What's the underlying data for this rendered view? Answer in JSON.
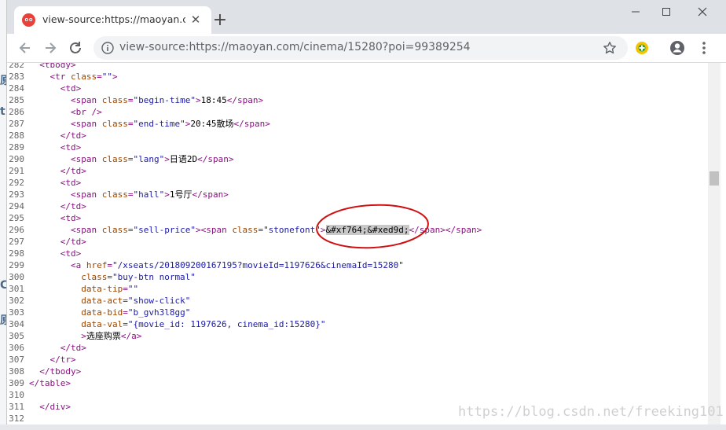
{
  "background_chars": [
    "原",
    "t",
    "C",
    "原"
  ],
  "browser": {
    "tab_title": "view-source:https://maoyan.cc",
    "new_tab_symbol": "+",
    "url": "view-source:https://maoyan.com/cinema/15280?poi=99389254",
    "window_controls": {
      "minimize": "—",
      "maximize": "☐",
      "close": "✕"
    }
  },
  "source_lines": [
    {
      "n": "282",
      "tokens": [
        [
          "t",
          "  <tbody>"
        ]
      ]
    },
    {
      "n": "283",
      "tokens": [
        [
          "t",
          "    <tr "
        ],
        [
          "a",
          "class"
        ],
        [
          "t",
          "="
        ],
        [
          "v",
          "\"\""
        ],
        [
          "t",
          ">"
        ]
      ]
    },
    {
      "n": "284",
      "tokens": [
        [
          "t",
          "      <td>"
        ]
      ]
    },
    {
      "n": "285",
      "tokens": [
        [
          "t",
          "        <span "
        ],
        [
          "a",
          "class"
        ],
        [
          "t",
          "="
        ],
        [
          "v",
          "\"begin-time\""
        ],
        [
          "t",
          ">"
        ],
        [
          "x",
          "18:45"
        ],
        [
          "t",
          "</span>"
        ]
      ]
    },
    {
      "n": "286",
      "tokens": [
        [
          "t",
          "        <br />"
        ]
      ]
    },
    {
      "n": "287",
      "tokens": [
        [
          "t",
          "        <span "
        ],
        [
          "a",
          "class"
        ],
        [
          "t",
          "="
        ],
        [
          "v",
          "\"end-time\""
        ],
        [
          "t",
          ">"
        ],
        [
          "x",
          "20:45散场"
        ],
        [
          "t",
          "</span>"
        ]
      ]
    },
    {
      "n": "288",
      "tokens": [
        [
          "t",
          "      </td>"
        ]
      ]
    },
    {
      "n": "289",
      "tokens": [
        [
          "t",
          "      <td>"
        ]
      ]
    },
    {
      "n": "290",
      "tokens": [
        [
          "t",
          "        <span "
        ],
        [
          "a",
          "class"
        ],
        [
          "t",
          "="
        ],
        [
          "v",
          "\"lang\""
        ],
        [
          "t",
          ">"
        ],
        [
          "x",
          "日语2D"
        ],
        [
          "t",
          "</span>"
        ]
      ]
    },
    {
      "n": "291",
      "tokens": [
        [
          "t",
          "      </td>"
        ]
      ]
    },
    {
      "n": "292",
      "tokens": [
        [
          "t",
          "      <td>"
        ]
      ]
    },
    {
      "n": "293",
      "tokens": [
        [
          "t",
          "        <span "
        ],
        [
          "a",
          "class"
        ],
        [
          "t",
          "="
        ],
        [
          "v",
          "\"hall\""
        ],
        [
          "t",
          ">"
        ],
        [
          "x",
          "1号厅"
        ],
        [
          "t",
          "</span>"
        ]
      ]
    },
    {
      "n": "294",
      "tokens": [
        [
          "t",
          "      </td>"
        ]
      ]
    },
    {
      "n": "295",
      "tokens": [
        [
          "t",
          "      <td>"
        ]
      ]
    },
    {
      "n": "296",
      "tokens": [
        [
          "t",
          "        <span "
        ],
        [
          "a",
          "class"
        ],
        [
          "t",
          "="
        ],
        [
          "v",
          "\"sell-price\""
        ],
        [
          "t",
          "><span "
        ],
        [
          "a",
          "class"
        ],
        [
          "t",
          "="
        ],
        [
          "v",
          "\"stonefont\""
        ],
        [
          "t",
          ">"
        ],
        [
          "hl",
          "&#xf764;&#xed9d;"
        ],
        [
          "t",
          "</span></span>"
        ]
      ]
    },
    {
      "n": "297",
      "tokens": [
        [
          "t",
          "      </td>"
        ]
      ]
    },
    {
      "n": "298",
      "tokens": [
        [
          "t",
          "      <td>"
        ]
      ]
    },
    {
      "n": "299",
      "tokens": [
        [
          "t",
          "        <a "
        ],
        [
          "a",
          "href"
        ],
        [
          "t",
          "="
        ],
        [
          "v",
          "\"/xseats/201809200167195?movieId=1197626&cinemaId=15280\""
        ]
      ]
    },
    {
      "n": "300",
      "tokens": [
        [
          "a",
          "          class"
        ],
        [
          "t",
          "="
        ],
        [
          "v",
          "\"buy-btn normal\""
        ]
      ]
    },
    {
      "n": "301",
      "tokens": [
        [
          "a",
          "          data-tip"
        ],
        [
          "t",
          "="
        ],
        [
          "v",
          "\"\""
        ]
      ]
    },
    {
      "n": "302",
      "tokens": [
        [
          "a",
          "          data-act"
        ],
        [
          "t",
          "="
        ],
        [
          "v",
          "\"show-click\""
        ]
      ]
    },
    {
      "n": "303",
      "tokens": [
        [
          "a",
          "          data-bid"
        ],
        [
          "t",
          "="
        ],
        [
          "v",
          "\"b_gvh3l8gg\""
        ]
      ]
    },
    {
      "n": "304",
      "tokens": [
        [
          "a",
          "          data-val"
        ],
        [
          "t",
          "="
        ],
        [
          "v",
          "\"{movie_id: 1197626, cinema_id:15280}\""
        ]
      ]
    },
    {
      "n": "305",
      "tokens": [
        [
          "t",
          "          >"
        ],
        [
          "x",
          "选座购票"
        ],
        [
          "t",
          "</a>"
        ]
      ]
    },
    {
      "n": "306",
      "tokens": [
        [
          "t",
          "      </td>"
        ]
      ]
    },
    {
      "n": "307",
      "tokens": [
        [
          "t",
          "    </tr>"
        ]
      ]
    },
    {
      "n": "308",
      "tokens": [
        [
          "t",
          "  </tbody>"
        ]
      ]
    },
    {
      "n": "309",
      "tokens": [
        [
          "t",
          "</table>"
        ]
      ]
    },
    {
      "n": "310",
      "tokens": []
    },
    {
      "n": "311",
      "tokens": [
        [
          "t",
          "  </div>"
        ]
      ]
    },
    {
      "n": "312",
      "tokens": []
    }
  ],
  "watermark": "https://blog.csdn.net/freeking101",
  "colors": {
    "tag": "#881280",
    "attribute": "#994500",
    "value": "#1a1aa6",
    "annotation": "#d01010",
    "highlight": "#c8c8c8"
  },
  "icons": [
    "maoyan-favicon",
    "back-arrow-icon",
    "forward-arrow-icon",
    "reload-icon",
    "info-icon",
    "star-icon",
    "extension-icon",
    "account-icon",
    "menu-kebab-icon"
  ]
}
